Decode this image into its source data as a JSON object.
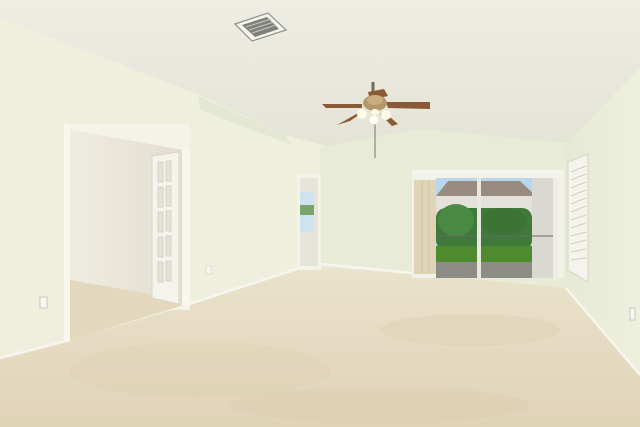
{
  "photo": {
    "subject": "empty-room-interior",
    "colors": {
      "ceiling": "#ecebe0",
      "wall_left": "#eef0dd",
      "wall_back": "#e8ebd6",
      "wall_right": "#e9ecd9",
      "carpet": "#e6dcc4",
      "trim": "#f4f3ea",
      "fan_blades": "#8a5a36",
      "sky": "#b8d7ef",
      "lawn": "#4f8a2f",
      "hedge": "#3f7a3a",
      "vent": "#8e8e8a"
    }
  }
}
